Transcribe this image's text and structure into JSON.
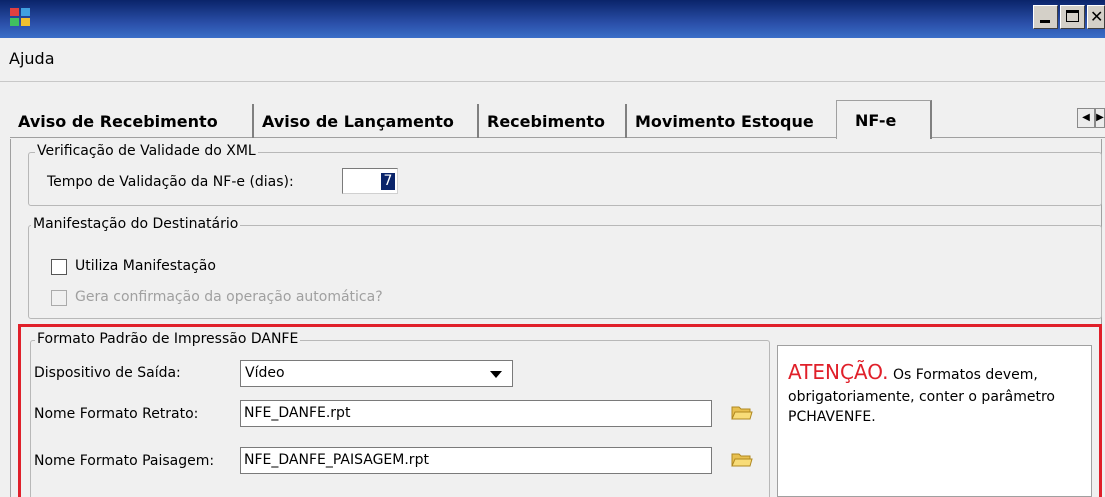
{
  "menu": {
    "help_label": "Ajuda"
  },
  "tabs": [
    {
      "label": "Aviso de Recebimento"
    },
    {
      "label": "Aviso de Lançamento"
    },
    {
      "label": "Recebimento"
    },
    {
      "label": "Movimento Estoque"
    },
    {
      "label": "NF-e",
      "active": true
    }
  ],
  "xml_validation": {
    "title": "Verificação de Validade do XML",
    "days_label": "Tempo de Validação da NF-e (dias):",
    "days_value": "7"
  },
  "recipient_manifest": {
    "title": "Manifestação do Destinatário",
    "use_manifest_label": "Utiliza Manifestação",
    "use_manifest_checked": false,
    "auto_confirm_label": "Gera confirmação da operação automática?",
    "auto_confirm_checked": false,
    "auto_confirm_enabled": false
  },
  "danfe_format": {
    "title": "Formato Padrão de Impressão DANFE",
    "output_label": "Dispositivo de Saída:",
    "output_value": "Vídeo",
    "portrait_label": "Nome Formato Retrato:",
    "portrait_value": "NFE_DANFE.rpt",
    "landscape_label": "Nome Formato Paisagem:",
    "landscape_value": "NFE_DANFE_PAISAGEM.rpt"
  },
  "note": {
    "title": "ATENÇÃO.",
    "text": " Os Formatos devem, obrigatoriamente, conter o parâmetro PCHAVENFE."
  },
  "colors": {
    "highlight": "#e0202a",
    "titlebar": "#0a246a",
    "selection": "#0a246a"
  },
  "icons": [
    "app-icon",
    "minimize-icon",
    "maximize-icon",
    "close-icon",
    "tab-scroll-left-icon",
    "tab-scroll-right-icon",
    "folder-icon"
  ]
}
